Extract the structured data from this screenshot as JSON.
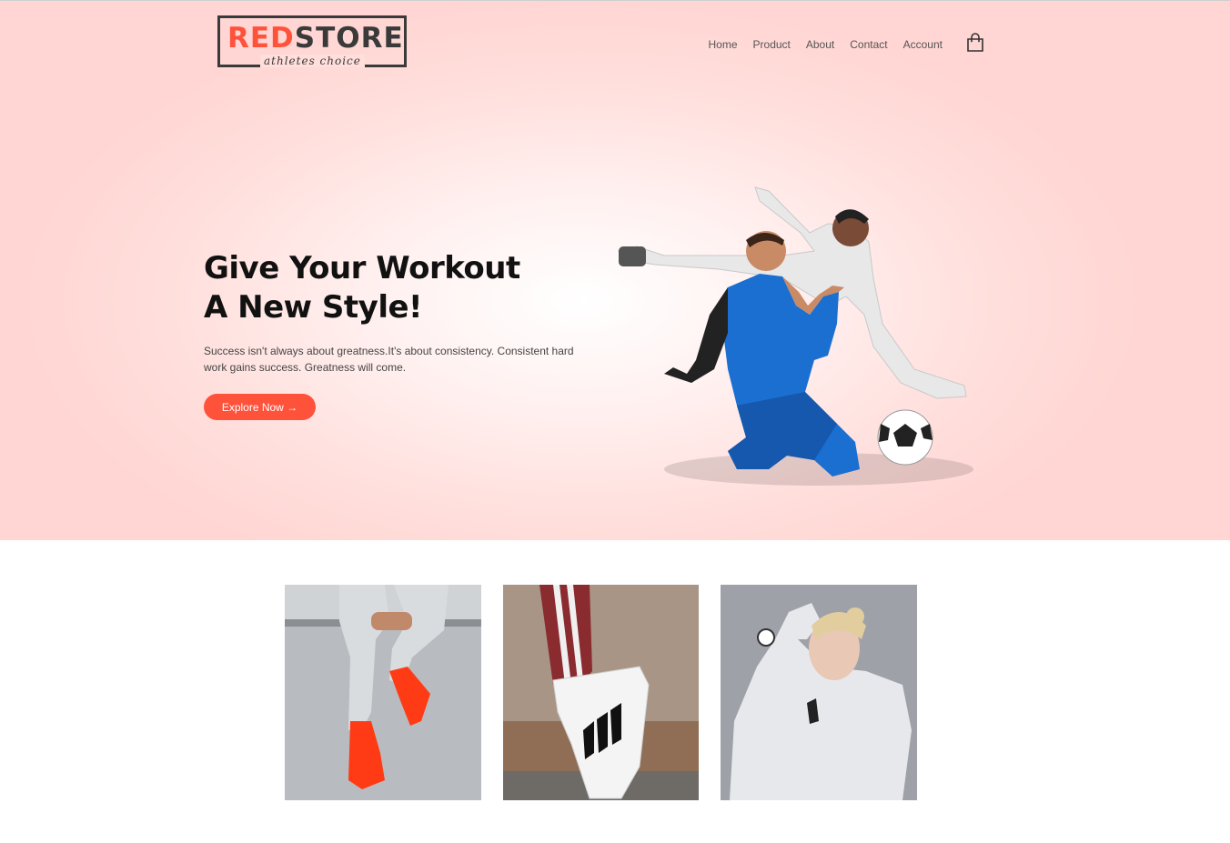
{
  "brand": {
    "name_red": "RED",
    "name_dark": "STORE",
    "tagline": "athletes choice"
  },
  "nav": {
    "items": [
      "Home",
      "Product",
      "About",
      "Contact",
      "Account"
    ],
    "cart_icon": "shopping-bag-icon"
  },
  "hero": {
    "headline_line1": "Give Your Workout",
    "headline_line2": "A New Style!",
    "subtext": "Success isn't always about greatness.It's about consistency. Consistent hard work gains success. Greatness will come.",
    "cta_label": "Explore Now →"
  },
  "colors": {
    "accent": "#ff523b",
    "hero_bg": "#ffdedb"
  },
  "categories": [
    {
      "icon": "red-sneakers-image"
    },
    {
      "icon": "striped-sneaker-image"
    },
    {
      "icon": "athlete-hoodie-image"
    }
  ]
}
